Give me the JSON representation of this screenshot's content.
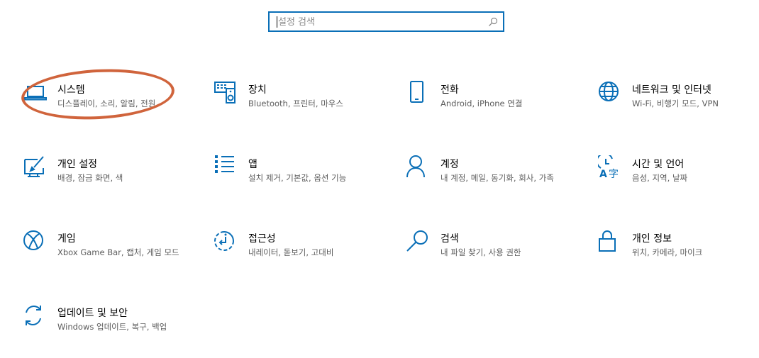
{
  "search": {
    "placeholder": "설정 검색",
    "icon": "search-icon"
  },
  "accent_color": "#0a6fb7",
  "highlight_color": "#d0643c",
  "categories": [
    {
      "title": "시스템",
      "desc": "디스플레이, 소리, 알림, 전원",
      "icon": "laptop-icon"
    },
    {
      "title": "장치",
      "desc": "Bluetooth, 프린터, 마우스",
      "icon": "keyboard-speaker-icon"
    },
    {
      "title": "전화",
      "desc": "Android, iPhone 연결",
      "icon": "phone-icon"
    },
    {
      "title": "네트워크 및 인터넷",
      "desc": "Wi-Fi, 비행기 모드, VPN",
      "icon": "globe-icon"
    },
    {
      "title": "개인 설정",
      "desc": "배경, 잠금 화면, 색",
      "icon": "paint-icon"
    },
    {
      "title": "앱",
      "desc": "설치 제거, 기본값, 옵션 기능",
      "icon": "apps-list-icon"
    },
    {
      "title": "계정",
      "desc": "내 계정, 메일, 동기화, 회사, 가족",
      "icon": "person-icon"
    },
    {
      "title": "시간 및 언어",
      "desc": "음성, 지역, 날짜",
      "icon": "time-language-icon"
    },
    {
      "title": "게임",
      "desc": "Xbox Game Bar, 캡처, 게임 모드",
      "icon": "xbox-icon"
    },
    {
      "title": "접근성",
      "desc": "내레이터, 돋보기, 고대비",
      "icon": "ease-of-access-icon"
    },
    {
      "title": "검색",
      "desc": "내 파일 찾기, 사용 권한",
      "icon": "search-magnifier-icon"
    },
    {
      "title": "개인 정보",
      "desc": "위치, 카메라, 마이크",
      "icon": "lock-icon"
    },
    {
      "title": "업데이트 및 보안",
      "desc": "Windows 업데이트, 복구, 백업",
      "icon": "update-icon"
    }
  ]
}
